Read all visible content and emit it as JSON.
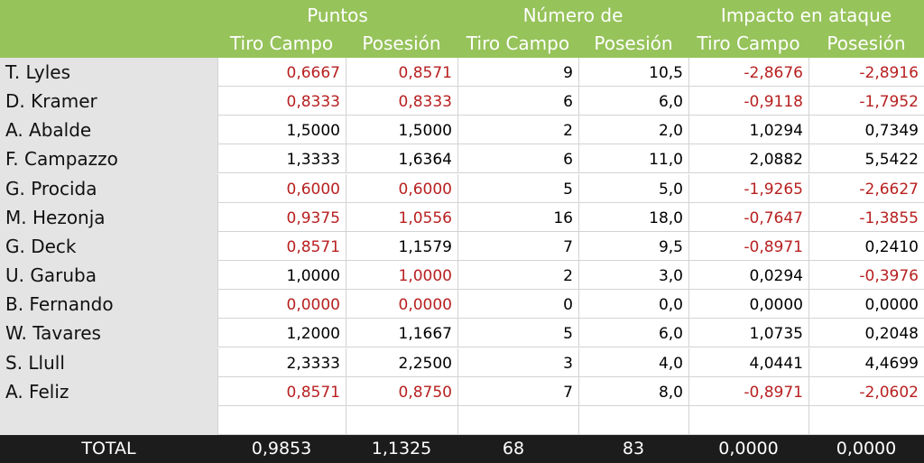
{
  "chart_data": {
    "type": "table",
    "header": {
      "groups": [
        "Puntos",
        "Número de",
        "Impacto en ataque"
      ],
      "columns": [
        "Tiro Campo",
        "Posesión",
        "Tiro Campo",
        "Posesión",
        "Tiro Campo",
        "Posesión"
      ]
    },
    "rows": [
      {
        "player": "T. Lyles",
        "values": [
          "0,6667",
          "0,8571",
          "9",
          "10,5",
          "-2,8676",
          "-2,8916"
        ],
        "negative": [
          true,
          true,
          false,
          false,
          true,
          true
        ]
      },
      {
        "player": "D. Kramer",
        "values": [
          "0,8333",
          "0,8333",
          "6",
          "6,0",
          "-0,9118",
          "-1,7952"
        ],
        "negative": [
          true,
          true,
          false,
          false,
          true,
          true
        ]
      },
      {
        "player": "A. Abalde",
        "values": [
          "1,5000",
          "1,5000",
          "2",
          "2,0",
          "1,0294",
          "0,7349"
        ],
        "negative": [
          false,
          false,
          false,
          false,
          false,
          false
        ]
      },
      {
        "player": "F. Campazzo",
        "values": [
          "1,3333",
          "1,6364",
          "6",
          "11,0",
          "2,0882",
          "5,5422"
        ],
        "negative": [
          false,
          false,
          false,
          false,
          false,
          false
        ]
      },
      {
        "player": "G. Procida",
        "values": [
          "0,6000",
          "0,6000",
          "5",
          "5,0",
          "-1,9265",
          "-2,6627"
        ],
        "negative": [
          true,
          true,
          false,
          false,
          true,
          true
        ]
      },
      {
        "player": "M. Hezonja",
        "values": [
          "0,9375",
          "1,0556",
          "16",
          "18,0",
          "-0,7647",
          "-1,3855"
        ],
        "negative": [
          true,
          true,
          false,
          false,
          true,
          true
        ]
      },
      {
        "player": "G. Deck",
        "values": [
          "0,8571",
          "1,1579",
          "7",
          "9,5",
          "-0,8971",
          "0,2410"
        ],
        "negative": [
          true,
          false,
          false,
          false,
          true,
          false
        ]
      },
      {
        "player": "U. Garuba",
        "values": [
          "1,0000",
          "1,0000",
          "2",
          "3,0",
          "0,0294",
          "-0,3976"
        ],
        "negative": [
          false,
          true,
          false,
          false,
          false,
          true
        ]
      },
      {
        "player": "B. Fernando",
        "values": [
          "0,0000",
          "0,0000",
          "0",
          "0,0",
          "0,0000",
          "0,0000"
        ],
        "negative": [
          true,
          true,
          false,
          false,
          false,
          false
        ]
      },
      {
        "player": "W. Tavares",
        "values": [
          "1,2000",
          "1,1667",
          "5",
          "6,0",
          "1,0735",
          "0,2048"
        ],
        "negative": [
          false,
          false,
          false,
          false,
          false,
          false
        ]
      },
      {
        "player": "S. Llull",
        "values": [
          "2,3333",
          "2,2500",
          "3",
          "4,0",
          "4,0441",
          "4,4699"
        ],
        "negative": [
          false,
          false,
          false,
          false,
          false,
          false
        ]
      },
      {
        "player": "A. Feliz",
        "values": [
          "0,8571",
          "0,8750",
          "7",
          "8,0",
          "-0,8971",
          "-2,0602"
        ],
        "negative": [
          true,
          true,
          false,
          false,
          true,
          true
        ]
      },
      {
        "player": "",
        "values": [
          "",
          "",
          "",
          "",
          "",
          ""
        ],
        "negative": [
          false,
          false,
          false,
          false,
          false,
          false
        ]
      }
    ],
    "total": {
      "label": "TOTAL",
      "values": [
        "0,9853",
        "1,1325",
        "68",
        "83",
        "0,0000",
        "0,0000"
      ]
    }
  },
  "colors": {
    "header_bg": "#96c35a",
    "header_text": "#ffffff",
    "names_bg": "#e4e4e4",
    "negative_text": "#b82020",
    "total_bg": "#1c1c1c",
    "total_text": "#ffffff"
  }
}
